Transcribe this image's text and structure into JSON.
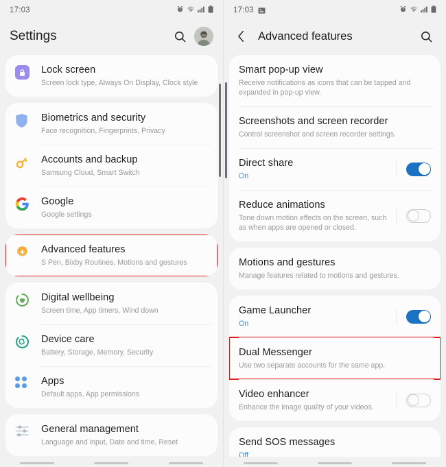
{
  "meta": {
    "accent_blue": "#3b8fd6",
    "toggle_on": "#1b72c4",
    "highlight_red": "#dc2020",
    "panel_bg": "#f1f1f1",
    "card_bg": "#fcfcfc"
  },
  "left": {
    "statusbar": {
      "time": "17:03",
      "icons": [
        "alarm-icon",
        "wifi-icon",
        "signal-icon",
        "battery-icon"
      ]
    },
    "appbar": {
      "title": "Settings",
      "search_icon": "search-icon",
      "avatar": "avatar"
    },
    "groups": [
      {
        "rows": [
          {
            "icon": "lock-icon",
            "title": "Lock screen",
            "sub": "Screen lock type, Always On Display, Clock style"
          }
        ]
      },
      {
        "rows": [
          {
            "icon": "shield-icon",
            "title": "Biometrics and security",
            "sub": "Face recognition, Fingerprints, Privacy"
          },
          {
            "icon": "key-icon",
            "title": "Accounts and backup",
            "sub": "Samsung Cloud, Smart Switch"
          },
          {
            "icon": "google-icon",
            "title": "Google",
            "sub": "Google settings"
          }
        ]
      },
      {
        "highlight": true,
        "rows": [
          {
            "icon": "gear-flower-icon",
            "title": "Advanced features",
            "sub": "S Pen, Bixby Routines, Motions and gestures"
          }
        ]
      },
      {
        "rows": [
          {
            "icon": "wellbeing-heart-icon",
            "title": "Digital wellbeing",
            "sub": "Screen time, App timers, Wind down"
          },
          {
            "icon": "device-care-icon",
            "title": "Device care",
            "sub": "Battery, Storage, Memory, Security"
          },
          {
            "icon": "apps-grid-icon",
            "title": "Apps",
            "sub": "Default apps, App permissions"
          }
        ]
      },
      {
        "rows": [
          {
            "icon": "sliders-icon",
            "title": "General management",
            "sub": "Language and input, Date and time, Reset"
          }
        ]
      }
    ],
    "navbar": {
      "pills": 3
    }
  },
  "right": {
    "statusbar": {
      "time": "17:03",
      "screenshot_icon": "screenshot-icon",
      "icons": [
        "alarm-icon",
        "wifi-icon",
        "signal-icon",
        "battery-icon"
      ]
    },
    "appbar": {
      "back_icon": "back-chevron-icon",
      "title": "Advanced features",
      "search_icon": "search-icon"
    },
    "groups": [
      {
        "rows": [
          {
            "title": "Smart pop-up view",
            "sub": "Receive notifications as icons that can be tapped and expanded in pop-up view.",
            "toggle": null
          },
          {
            "title": "Screenshots and screen recorder",
            "sub": "Control screenshot and screen recorder settings.",
            "toggle": null
          },
          {
            "title": "Direct share",
            "sub": "On",
            "sub_accent": true,
            "toggle": "on"
          },
          {
            "title": "Reduce animations",
            "sub": "Tone down motion effects on the screen, such as when apps are opened or closed.",
            "toggle": "off"
          }
        ]
      },
      {
        "rows": [
          {
            "title": "Motions and gestures",
            "sub": "Manage features related to motions and gestures.",
            "toggle": null
          }
        ]
      },
      {
        "rows": [
          {
            "title": "Game Launcher",
            "sub": "On",
            "sub_accent": true,
            "toggle": "on"
          },
          {
            "title": "Dual Messenger",
            "sub": "Use two separate accounts for the same app.",
            "toggle": null,
            "highlight": true
          },
          {
            "title": "Video enhancer",
            "sub": "Enhance the image quality of your videos.",
            "toggle": "off"
          }
        ]
      },
      {
        "rows": [
          {
            "title": "Send SOS messages",
            "sub": "Off",
            "sub_accent": true,
            "toggle": null
          }
        ]
      }
    ],
    "navbar": {
      "pills": 3
    }
  }
}
